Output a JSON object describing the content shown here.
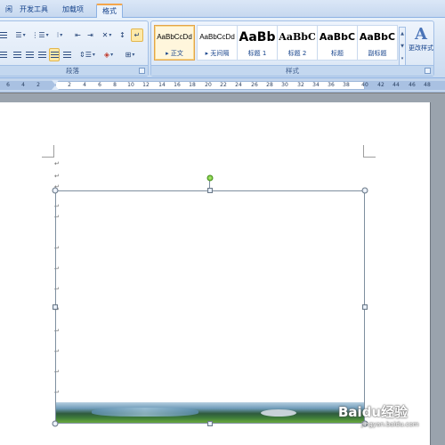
{
  "tabs": [
    {
      "label": "闲"
    },
    {
      "label": "开发工具"
    },
    {
      "label": "加载项"
    },
    {
      "label": "格式"
    }
  ],
  "ribbon": {
    "paragraph_group": {
      "label": "段落"
    },
    "styles_group": {
      "label": "样式",
      "styles": [
        {
          "sample": "AaBbCcDd",
          "name": "▸ 正文",
          "selected": true
        },
        {
          "sample": "AaBbCcDd",
          "name": "▸ 无间隔",
          "selected": false
        },
        {
          "sample": "AaBb",
          "name": "标题 1",
          "selected": false
        },
        {
          "sample": "AaBbC",
          "name": "标题 2",
          "selected": false
        },
        {
          "sample": "AaBbC",
          "name": "标题",
          "selected": false
        },
        {
          "sample": "AaBbC",
          "name": "副标题",
          "selected": false
        }
      ],
      "change_styles_label": "更改样式"
    }
  },
  "ruler": {
    "ticks": [
      "6",
      "4",
      "2",
      "2",
      "4",
      "6",
      "8",
      "10",
      "12",
      "14",
      "16",
      "18",
      "20",
      "22",
      "24",
      "26",
      "28",
      "30",
      "32",
      "34",
      "36",
      "38",
      "40",
      "42",
      "44",
      "46",
      "48"
    ]
  },
  "document": {
    "paragraph_mark": "↵"
  },
  "watermark": {
    "brand": "Baidu经验",
    "url": "jingyan.baidu.com"
  },
  "colors": {
    "rotation_handle": "#5fb82a",
    "selected_style_border": "#e3a44b"
  }
}
